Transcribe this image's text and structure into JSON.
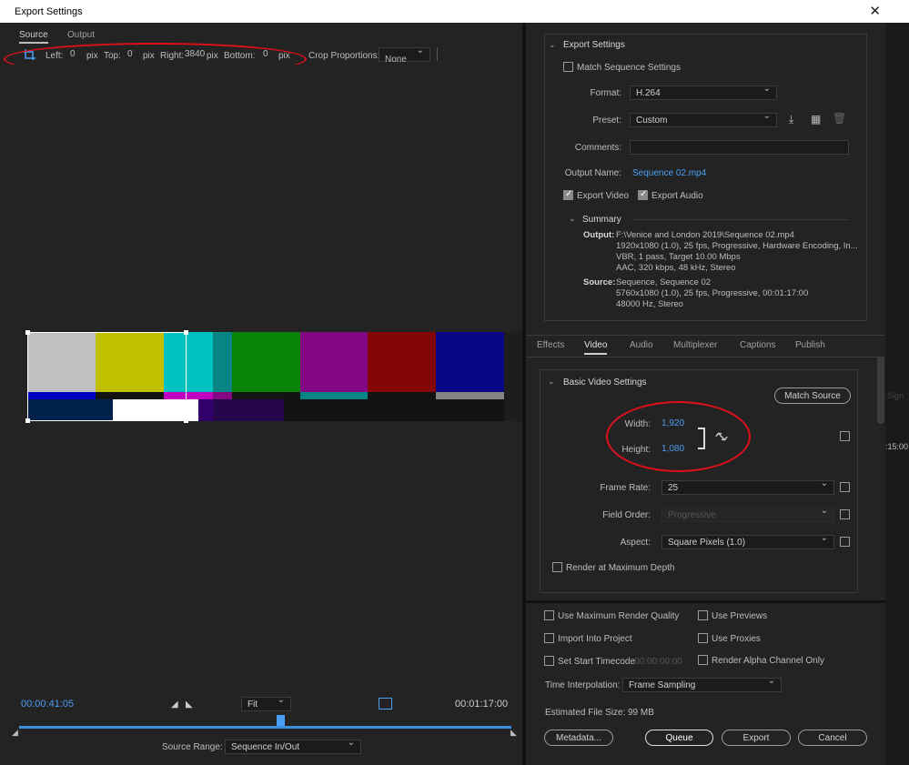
{
  "window": {
    "title": "Export Settings",
    "close_icon": "close-icon"
  },
  "left_tabs": [
    "Source",
    "Output"
  ],
  "crop": {
    "left_label": "Left:",
    "left_value": "0",
    "left_unit": "pix",
    "top_label": "Top:",
    "top_value": "0",
    "top_unit": "pix",
    "right_label": "Right:",
    "right_value": "3840",
    "right_unit": "pix",
    "bottom_label": "Bottom:",
    "bottom_value": "0",
    "bottom_unit": "pix",
    "proportions_label": "Crop Proportions:",
    "proportions_value": "None"
  },
  "timeline": {
    "current_time": "00:00:41:05",
    "zoom": "Fit",
    "duration": "00:01:17:00",
    "source_range_label": "Source Range:",
    "source_range_value": "Sequence In/Out",
    "playhead_fraction": 0.53
  },
  "export_settings": {
    "header": "Export Settings",
    "match_sequence": "Match Sequence Settings",
    "format_label": "Format:",
    "format_value": "H.264",
    "preset_label": "Preset:",
    "preset_value": "Custom",
    "comments_label": "Comments:",
    "output_name_label": "Output Name:",
    "output_name_value": "Sequence 02.mp4",
    "export_video": "Export Video",
    "export_audio": "Export Audio",
    "summary_header": "Summary",
    "output_label": "Output:",
    "output_lines": [
      "F:\\Venice and London 2019\\Sequence 02.mp4",
      "1920x1080 (1.0), 25 fps, Progressive, Hardware Encoding, In...",
      "VBR, 1 pass, Target 10.00 Mbps",
      "AAC, 320 kbps, 48 kHz, Stereo"
    ],
    "source_label": "Source:",
    "source_lines": [
      "Sequence, Sequence 02",
      "5760x1080 (1.0), 25 fps, Progressive, 00:01:17:00",
      "48000 Hz, Stereo"
    ]
  },
  "settings_tabs": [
    "Effects",
    "Video",
    "Audio",
    "Multiplexer",
    "Captions",
    "Publish"
  ],
  "video": {
    "header": "Basic Video Settings",
    "match_source": "Match Source",
    "width_label": "Width:",
    "width_value": "1,920",
    "height_label": "Height:",
    "height_value": "1,080",
    "frame_rate_label": "Frame Rate:",
    "frame_rate_value": "25",
    "field_order_label": "Field Order:",
    "field_order_value": "Progressive",
    "aspect_label": "Aspect:",
    "aspect_value": "Square Pixels (1.0)",
    "render_max_depth": "Render at Maximum Depth"
  },
  "bottom": {
    "use_max_render": "Use Maximum Render Quality",
    "use_previews": "Use Previews",
    "import_project": "Import Into Project",
    "use_proxies": "Use Proxies",
    "set_start_tc": "Set Start Timecode",
    "start_tc_value": "00:00:00:00",
    "render_alpha": "Render Alpha Channel Only",
    "time_interp_label": "Time Interpolation:",
    "time_interp_value": "Frame Sampling",
    "est_size_label": "Estimated File Size:",
    "est_size_value": "99 MB",
    "metadata_btn": "Metadata...",
    "queue_btn": "Queue",
    "export_btn": "Export",
    "cancel_btn": "Cancel"
  },
  "background_app": {
    "peek_label": "Sign",
    "peek_time": ":15:00"
  },
  "colors": {
    "accent": "#4a9ff5",
    "annotation": "#e0101a"
  }
}
